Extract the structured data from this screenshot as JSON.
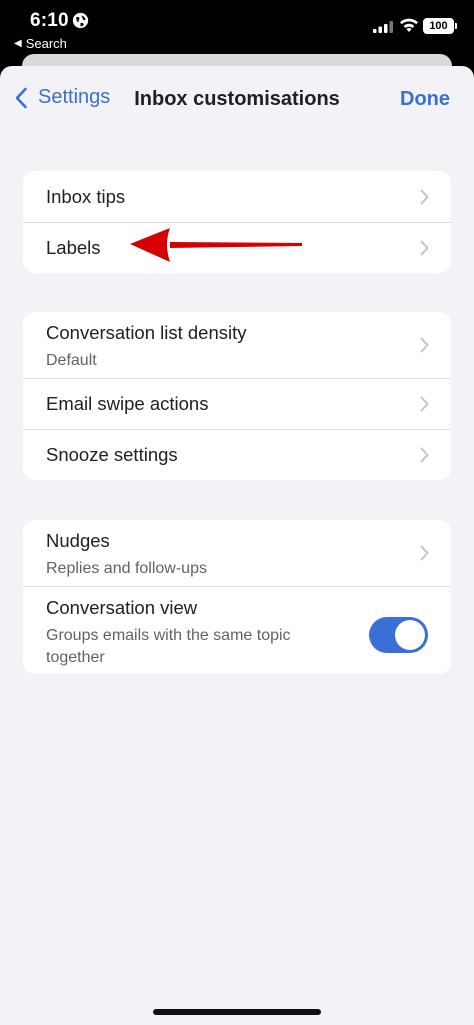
{
  "status_bar": {
    "time": "6:10",
    "back_app_label": "Search",
    "battery": "100"
  },
  "nav": {
    "back_label": "Settings",
    "title": "Inbox customisations",
    "done_label": "Done"
  },
  "groups": [
    {
      "rows": [
        {
          "title": "Inbox tips"
        },
        {
          "title": "Labels"
        }
      ]
    },
    {
      "rows": [
        {
          "title": "Conversation list density",
          "subtitle": "Default"
        },
        {
          "title": "Email swipe actions"
        },
        {
          "title": "Snooze settings"
        }
      ]
    },
    {
      "rows": [
        {
          "title": "Nudges",
          "subtitle": "Replies and follow-ups"
        },
        {
          "title": "Conversation view",
          "subtitle": "Groups emails with the same topic together",
          "toggle_on": true
        }
      ]
    }
  ],
  "colors": {
    "accent": "#3a6fd6",
    "background": "#f2f2f7",
    "annotation_arrow": "#d60000"
  }
}
